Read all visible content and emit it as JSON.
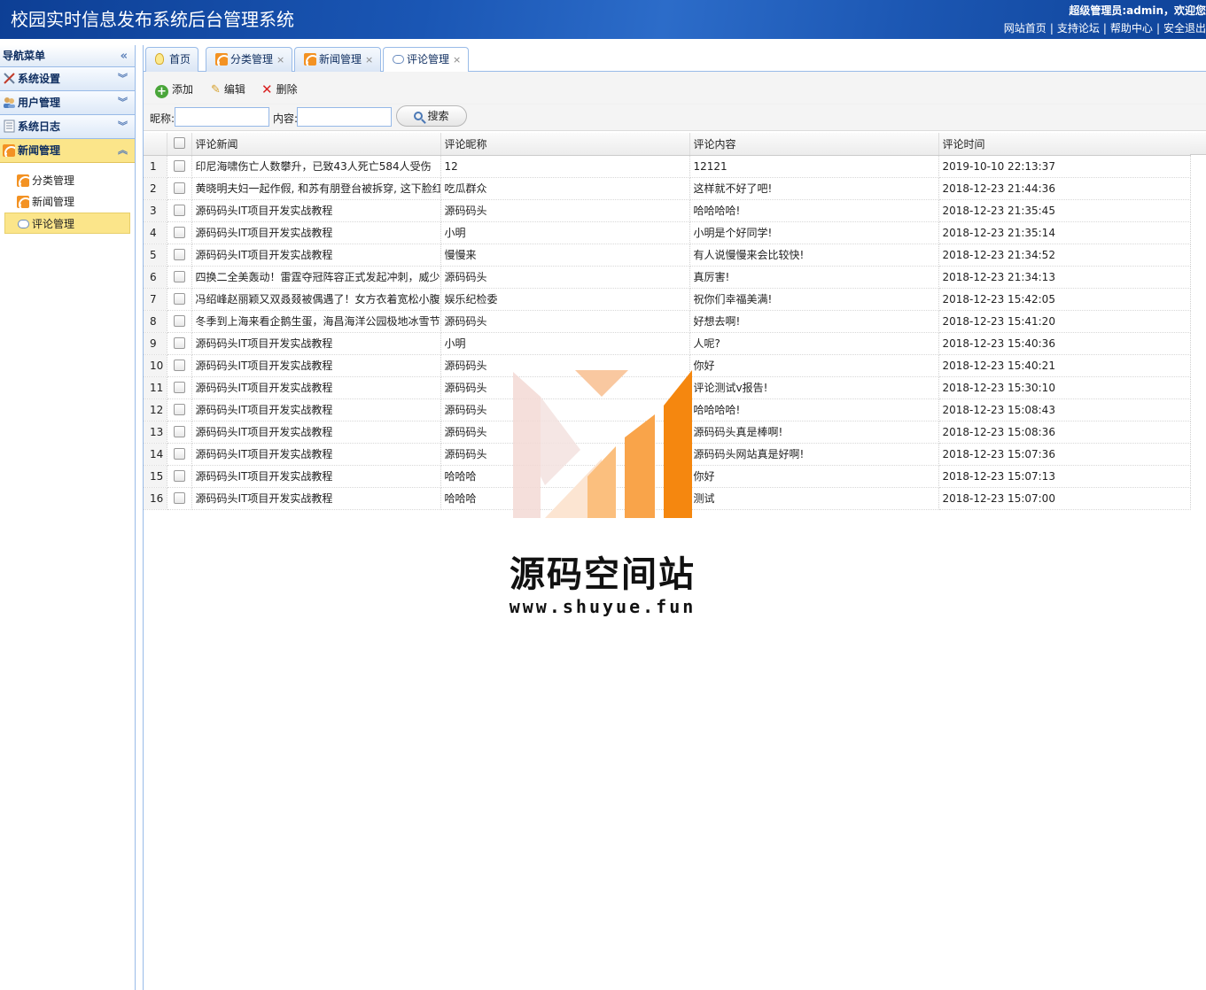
{
  "header": {
    "title": "校园实时信息发布系统后台管理系统",
    "user_line": "超级管理员:admin，欢迎您",
    "links": [
      "网站首页",
      "支持论坛",
      "帮助中心",
      "安全退出"
    ]
  },
  "sidebar": {
    "title": "导航菜单",
    "groups": [
      {
        "label": "系统设置",
        "icon": "tools-icon",
        "expanded": false
      },
      {
        "label": "用户管理",
        "icon": "users-icon",
        "expanded": false
      },
      {
        "label": "系统日志",
        "icon": "log-icon",
        "expanded": false
      },
      {
        "label": "新闻管理",
        "icon": "rss-icon",
        "expanded": true
      }
    ],
    "sub_items": [
      {
        "label": "分类管理",
        "icon": "rss-icon"
      },
      {
        "label": "新闻管理",
        "icon": "rss-icon"
      },
      {
        "label": "评论管理",
        "icon": "comment-icon",
        "active": true
      }
    ]
  },
  "tabs": [
    {
      "label": "首页",
      "icon": "bulb-icon",
      "closable": false
    },
    {
      "label": "分类管理",
      "icon": "rss-icon",
      "closable": true
    },
    {
      "label": "新闻管理",
      "icon": "rss-icon",
      "closable": true
    },
    {
      "label": "评论管理",
      "icon": "comment-icon",
      "closable": true,
      "active": true
    }
  ],
  "tab_close": "×",
  "toolbar": {
    "add": "添加",
    "edit": "编辑",
    "delete": "删除"
  },
  "search": {
    "nickname_label": "昵称:",
    "content_label": "内容:",
    "nickname_value": "",
    "content_value": "",
    "button": "搜索"
  },
  "grid": {
    "columns": [
      "评论新闻",
      "评论昵称",
      "评论内容",
      "评论时间"
    ],
    "rows": [
      {
        "n": "1",
        "news": "印尼海啸伤亡人数攀升，已致43人死亡584人受伤",
        "nick": "12",
        "content": "12121",
        "time": "2019-10-10 22:13:37"
      },
      {
        "n": "2",
        "news": "黄晓明夫妇一起作假, 和苏有朋登台被拆穿, 这下脸红",
        "nick": "吃瓜群众",
        "content": "这样就不好了吧!",
        "time": "2018-12-23 21:44:36"
      },
      {
        "n": "3",
        "news": "源码码头IT项目开发实战教程",
        "nick": "源码码头",
        "content": "哈哈哈哈!",
        "time": "2018-12-23 21:35:45"
      },
      {
        "n": "4",
        "news": "源码码头IT项目开发实战教程",
        "nick": "小明",
        "content": "小明是个好同学!",
        "time": "2018-12-23 21:35:14"
      },
      {
        "n": "5",
        "news": "源码码头IT项目开发实战教程",
        "nick": "慢慢来",
        "content": "有人说慢慢来会比较快!",
        "time": "2018-12-23 21:34:52"
      },
      {
        "n": "6",
        "news": "四换二全美轰动！雷霆夺冠阵容正式发起冲刺，威少",
        "nick": "源码码头",
        "content": "真厉害!",
        "time": "2018-12-23 21:34:13"
      },
      {
        "n": "7",
        "news": "冯绍峰赵丽颖又双叒叕被偶遇了！女方衣着宽松小腹",
        "nick": "娱乐纪检委",
        "content": "祝你们幸福美满!",
        "time": "2018-12-23 15:42:05"
      },
      {
        "n": "8",
        "news": "冬季到上海来看企鹅生蛋，海昌海洋公园极地冰雪节",
        "nick": "源码码头",
        "content": "好想去啊!",
        "time": "2018-12-23 15:41:20"
      },
      {
        "n": "9",
        "news": "源码码头IT项目开发实战教程",
        "nick": "小明",
        "content": "人呢?",
        "time": "2018-12-23 15:40:36"
      },
      {
        "n": "10",
        "news": "源码码头IT项目开发实战教程",
        "nick": "源码码头",
        "content": "你好",
        "time": "2018-12-23 15:40:21"
      },
      {
        "n": "11",
        "news": "源码码头IT项目开发实战教程",
        "nick": "源码码头",
        "content": "评论测试v报告!",
        "time": "2018-12-23 15:30:10"
      },
      {
        "n": "12",
        "news": "源码码头IT项目开发实战教程",
        "nick": "源码码头",
        "content": "哈哈哈哈!",
        "time": "2018-12-23 15:08:43"
      },
      {
        "n": "13",
        "news": "源码码头IT项目开发实战教程",
        "nick": "源码码头",
        "content": "源码码头真是棒啊!",
        "time": "2018-12-23 15:08:36"
      },
      {
        "n": "14",
        "news": "源码码头IT项目开发实战教程",
        "nick": "源码码头",
        "content": "源码码头网站真是好啊!",
        "time": "2018-12-23 15:07:36"
      },
      {
        "n": "15",
        "news": "源码码头IT项目开发实战教程",
        "nick": "哈哈哈",
        "content": "你好",
        "time": "2018-12-23 15:07:13"
      },
      {
        "n": "16",
        "news": "源码码头IT项目开发实战教程",
        "nick": "哈哈哈",
        "content": "测试",
        "time": "2018-12-23 15:07:00"
      }
    ]
  },
  "watermark": {
    "name": "源码空间站",
    "url": "www.shuyue.fun"
  },
  "colors": {
    "header": "#1a56b4",
    "active": "#fbe58a",
    "border": "#99bbe8",
    "orange": "#f5870f"
  }
}
